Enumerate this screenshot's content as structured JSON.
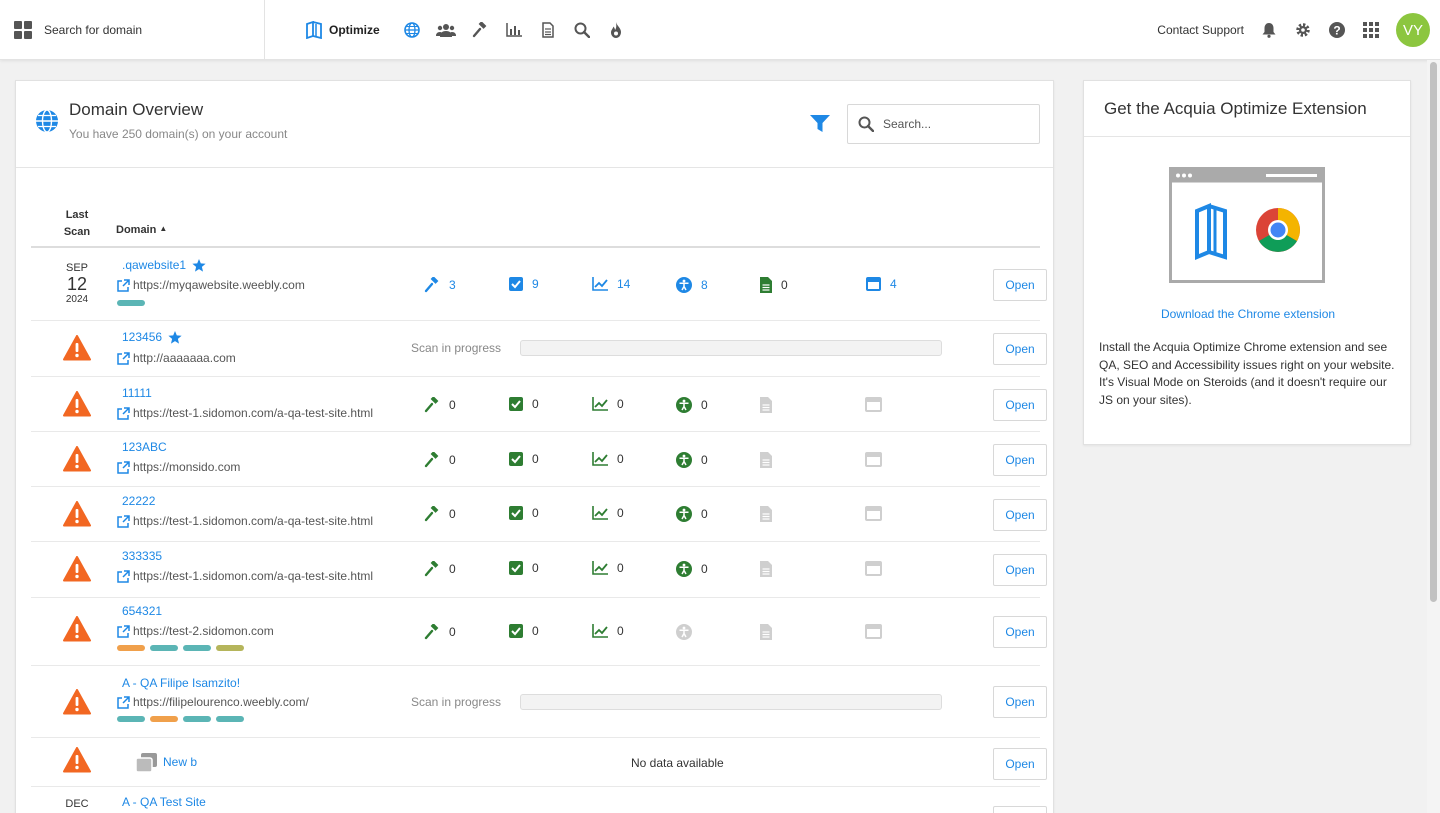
{
  "topbar": {
    "search_label": "Search for domain",
    "brand": "Optimize",
    "contact_support": "Contact Support",
    "avatar_initials": "VY",
    "nav_icons": [
      "globe-icon",
      "users-icon",
      "gavel-icon",
      "bar-chart-icon",
      "document-icon",
      "search-icon",
      "fire-icon"
    ]
  },
  "overview": {
    "title": "Domain Overview",
    "subtitle": "You have 250 domain(s) on your account",
    "search_placeholder": "Search...",
    "col_last_scan_1": "Last",
    "col_last_scan_2": "Scan",
    "col_domain": "Domain",
    "open_label": "Open",
    "scan_in_progress": "Scan in progress",
    "no_data": "No data available",
    "rows": [
      {
        "date_mon": "SEP",
        "date_day": "12",
        "date_year": "2024",
        "name": ".qawebsite1",
        "url": "https://myqawebsite.weebly.com",
        "qa": "3",
        "check": "9",
        "seo": "14",
        "a11y": "8",
        "docs": "0",
        "ext": "4"
      },
      {
        "name": "123456",
        "url": "http://aaaaaaa.com"
      },
      {
        "name": "11111",
        "url": "https://test-1.sidomon.com/a-qa-test-site.html",
        "qa": "0",
        "check": "0",
        "seo": "0",
        "a11y": "0"
      },
      {
        "name": "123ABC",
        "url": "https://monsido.com",
        "qa": "0",
        "check": "0",
        "seo": "0",
        "a11y": "0"
      },
      {
        "name": "22222",
        "url": "https://test-1.sidomon.com/a-qa-test-site.html",
        "qa": "0",
        "check": "0",
        "seo": "0",
        "a11y": "0"
      },
      {
        "name": "333335",
        "url": "https://test-1.sidomon.com/a-qa-test-site.html",
        "qa": "0",
        "check": "0",
        "seo": "0",
        "a11y": "0"
      },
      {
        "name": "654321",
        "url": "https://test-2.sidomon.com",
        "qa": "0",
        "check": "0",
        "seo": "0"
      },
      {
        "name": "A - QA Filipe Isamzito!",
        "url": "https://filipelourenco.weebly.com/"
      },
      {
        "name": "New b"
      },
      {
        "date_mon": "DEC",
        "name": "A - QA Test Site"
      }
    ]
  },
  "extension": {
    "title": "Get the Acquia Optimize Extension",
    "link": "Download the Chrome extension",
    "description": "Install the Acquia Optimize Chrome extension and see QA, SEO and Accessibility issues right on your website. It's Visual Mode on Steroids (and it doesn't require our JS on your sites)."
  },
  "colors": {
    "accent_blue": "#1e88e5",
    "warning_orange": "#f26722",
    "metric_green": "#2e7d32",
    "tag_teal": "#5bb5b5",
    "tag_orange": "#f0a04b",
    "tag_olive": "#b5b55b",
    "avatar_green": "#8cc63f"
  }
}
